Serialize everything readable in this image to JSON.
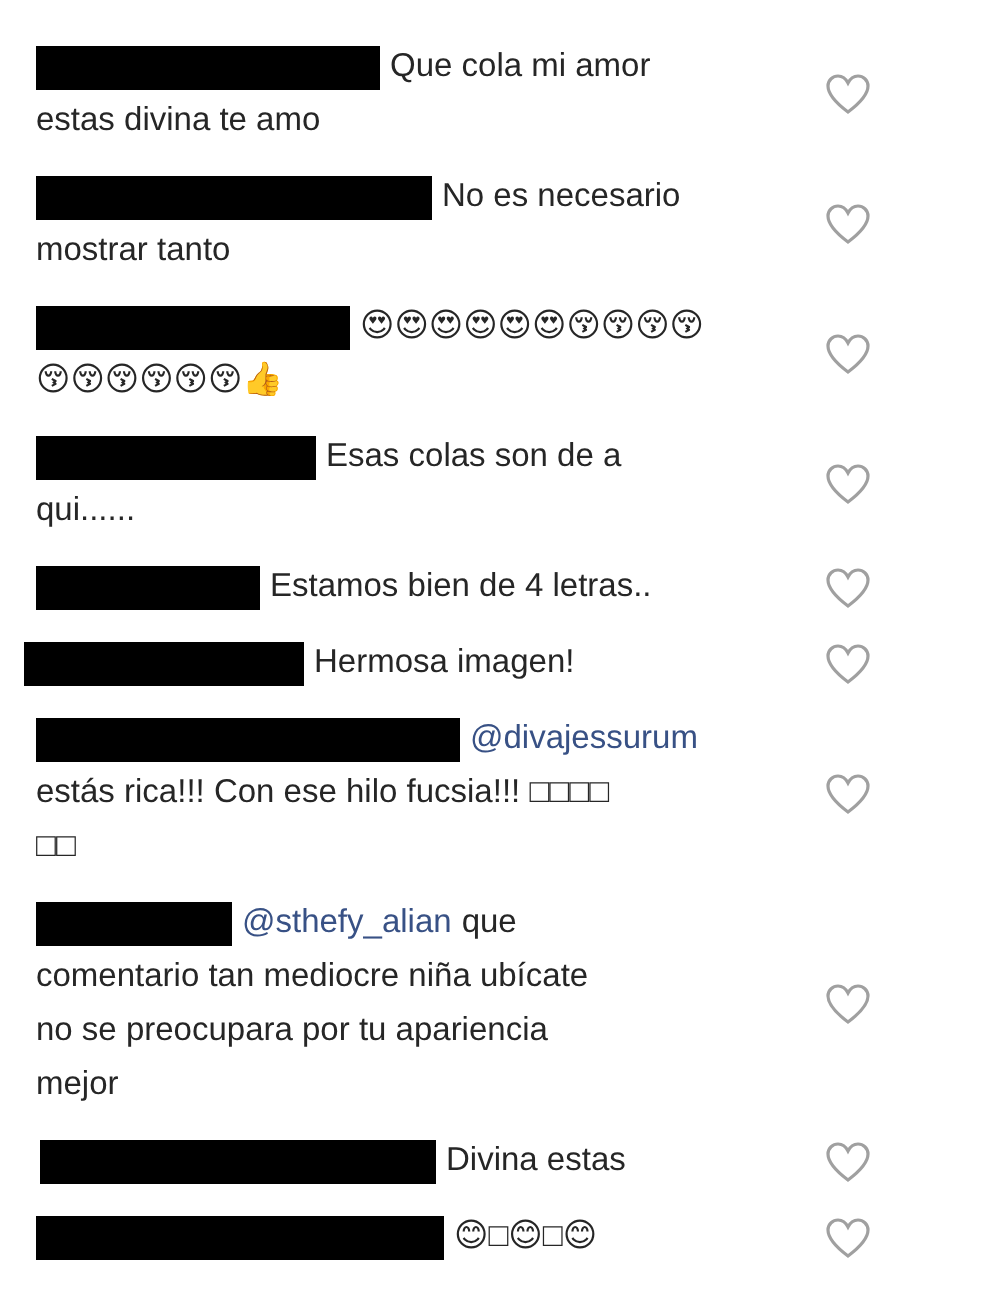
{
  "comments": [
    {
      "first_line": "Que cola mi amor",
      "lines": [
        "estas divina te amo"
      ],
      "liked": false
    },
    {
      "first_line": "No es necesario",
      "lines": [
        "mostrar tanto"
      ],
      "liked": false
    },
    {
      "first_line": "😍😍😍😍😍😍😚😚😚😚",
      "lines": [
        "😚😚😚😚😚😚👍"
      ],
      "liked": false
    },
    {
      "first_line": "Esas colas son de a",
      "lines": [
        "qui......"
      ],
      "liked": false
    },
    {
      "first_line": "Estamos bien de 4 letras..",
      "liked": false
    },
    {
      "first_line": "Hermosa imagen!",
      "liked": false
    },
    {
      "mention": "@divajessurum",
      "lines": [
        "estás rica!!! Con ese hilo fucsia!!! □□□□",
        "□□"
      ],
      "liked": false
    },
    {
      "mention": "@sthefy_alian",
      "first_line": "que",
      "lines": [
        "comentario tan mediocre niña ubícate",
        "no se preocupara por tu apariencia",
        "mejor"
      ],
      "liked": false
    },
    {
      "first_line": "Divina estas",
      "liked": false
    },
    {
      "first_line": "😊□😊□😊",
      "liked": false
    }
  ]
}
